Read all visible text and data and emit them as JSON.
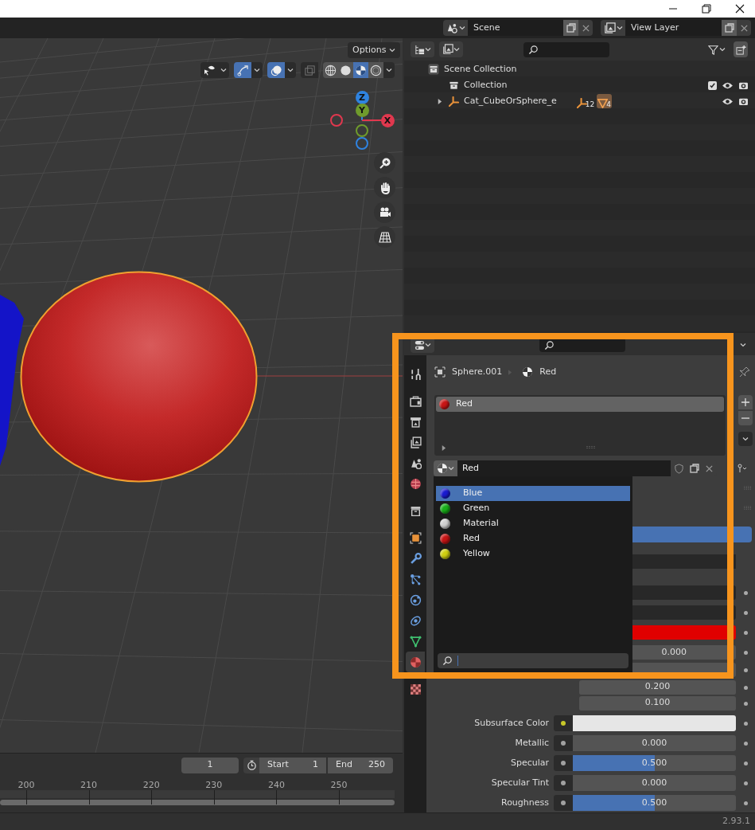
{
  "top_bar": {
    "scene": "Scene",
    "view_layer": "View Layer"
  },
  "viewport": {
    "options": "Options",
    "toggles": [
      {
        "kind": "selectability",
        "on": false
      },
      {
        "kind": "gizmo",
        "on": true
      },
      {
        "kind": "overlays",
        "on": true
      },
      {
        "kind": "xray",
        "on": false
      }
    ],
    "shading": [
      {
        "kind": "wireframe",
        "selected": false
      },
      {
        "kind": "solid",
        "selected": false
      },
      {
        "kind": "material",
        "selected": true
      },
      {
        "kind": "rendered",
        "selected": false
      }
    ],
    "gizmo": [
      {
        "label": "Z",
        "color": "#2f83e0"
      },
      {
        "label": "Y",
        "color": "#6f9b2c"
      },
      {
        "label": "X",
        "color": "#e0384e"
      }
    ]
  },
  "timeline": {
    "current_frame": "1",
    "start_label": "Start",
    "start": "1",
    "end_label": "End",
    "end": "250",
    "ruler": [
      "200",
      "210",
      "220",
      "230",
      "240",
      "250"
    ]
  },
  "outliner": {
    "tree": [
      {
        "label": "Scene Collection",
        "kind": "scene_collection",
        "children": [
          {
            "label": "Collection",
            "kind": "collection",
            "checked": true
          },
          {
            "label": "Cat_CubeOrSphere_e",
            "kind": "armature",
            "expanded": false,
            "badges": [
              "12",
              "4"
            ]
          }
        ]
      }
    ]
  },
  "properties": {
    "tabs": [
      {
        "kind": "tool",
        "selected": false
      },
      {
        "kind": "render",
        "selected": false
      },
      {
        "kind": "output",
        "selected": false
      },
      {
        "kind": "view_layer",
        "selected": false
      },
      {
        "kind": "scene",
        "selected": false
      },
      {
        "kind": "world",
        "selected": false
      },
      {
        "kind": "collection",
        "selected": false
      },
      {
        "kind": "object",
        "selected": false
      },
      {
        "kind": "modifiers",
        "selected": false
      },
      {
        "kind": "particles",
        "selected": false
      },
      {
        "kind": "physics",
        "selected": false
      },
      {
        "kind": "constraints",
        "selected": false
      },
      {
        "kind": "data",
        "selected": false
      },
      {
        "kind": "material",
        "selected": true
      },
      {
        "kind": "texture",
        "selected": false
      }
    ],
    "breadcrumb": [
      "Sphere.001",
      "Red"
    ],
    "slots": [
      {
        "label": "Red",
        "color": "#c81414",
        "selected": true
      }
    ],
    "material_name": "Red",
    "material_menu": [
      {
        "label": "Blue",
        "color": "#1a1ad0",
        "selected": true
      },
      {
        "label": "Green",
        "color": "#18b018",
        "selected": false
      },
      {
        "label": "Material",
        "color": "#d0d0d0",
        "selected": false
      },
      {
        "label": "Red",
        "color": "#c81414",
        "selected": false
      },
      {
        "label": "Yellow",
        "color": "#d0d010",
        "selected": false
      }
    ],
    "partly_hidden_value": "0.000",
    "inputs": [
      {
        "kind": "value",
        "value": "0.200"
      },
      {
        "kind": "value",
        "value": "0.100"
      },
      {
        "kind": "color",
        "label": "Subsurface Color",
        "color": "#e6e6e6"
      },
      {
        "kind": "slider",
        "label": "Metallic",
        "value": "0.000",
        "level": 0
      },
      {
        "kind": "slider",
        "label": "Specular",
        "value": "0.500",
        "level": 0.5
      },
      {
        "kind": "slider",
        "label": "Specular Tint",
        "value": "0.000",
        "level": 0
      },
      {
        "kind": "slider",
        "label": "Roughness",
        "value": "0.500",
        "level": 0.5
      }
    ]
  },
  "status_bar": {
    "version": "2.93.1"
  }
}
